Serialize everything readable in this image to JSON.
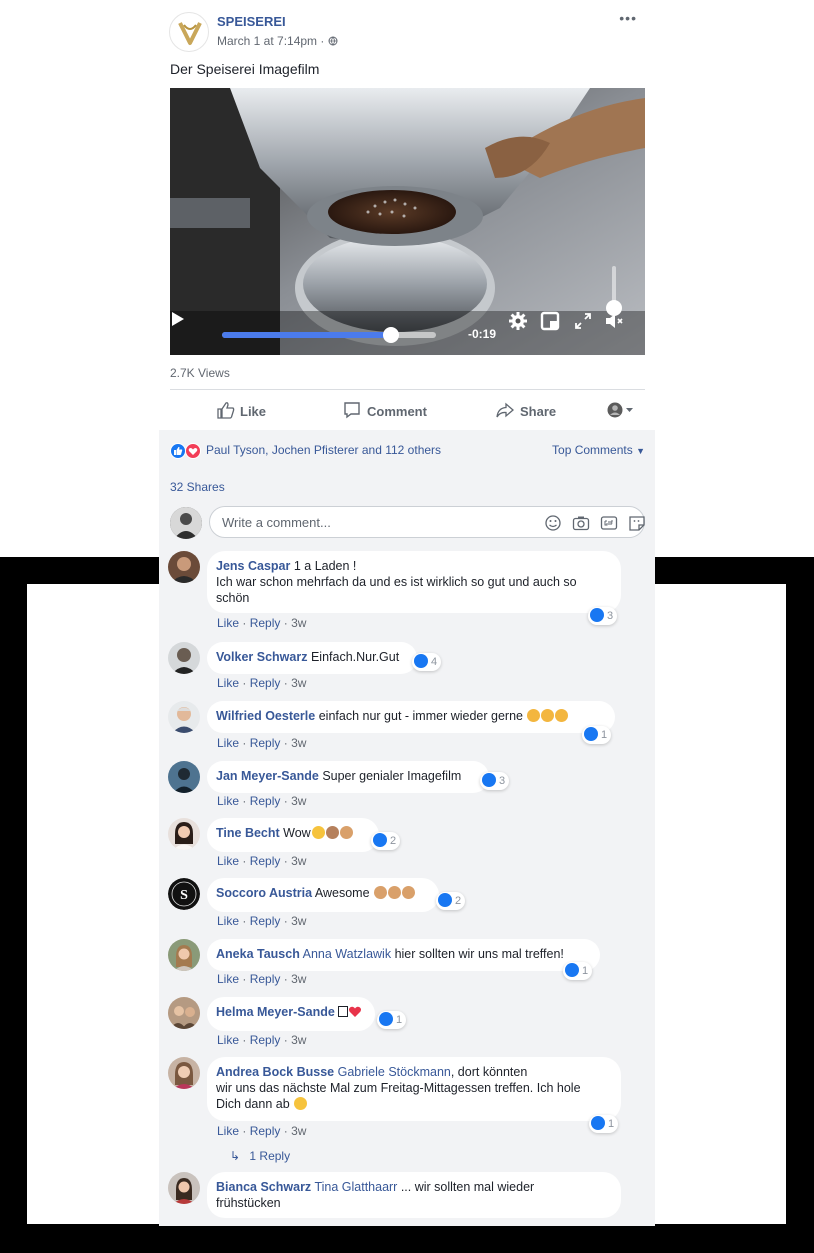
{
  "post": {
    "page_name": "SPEISEREI",
    "timestamp": "March 1 at 7:14pm",
    "time_separator": "·",
    "more_icon": "more-dots-icon",
    "text": "Der Speiserei Imagefilm",
    "video": {
      "time_remaining": "-0:19",
      "progress": 0.79,
      "volume": 0.0,
      "icons": [
        "play-icon",
        "settings-icon",
        "pip-icon",
        "fullscreen-icon",
        "mute-icon"
      ]
    },
    "views": "2.7K Views",
    "actions": {
      "like": "Like",
      "comment": "Comment",
      "share": "Share"
    },
    "reactions": {
      "summary": "Paul Tyson, Jochen Pfisterer and 112 others",
      "top_comments": "Top Comments"
    },
    "shares": "32 Shares",
    "comment_input": {
      "placeholder": "Write a comment..."
    }
  },
  "colors": {
    "link": "#385898",
    "like_blue": "#1877f2",
    "love_red": "#f33e58",
    "black_frame": "#000000"
  },
  "comment_actions": {
    "like": "Like",
    "reply": "Reply",
    "dot": "·"
  },
  "comments": [
    {
      "author": "Jens Caspar",
      "text": "1 a Laden !",
      "text2": "Ich war schon mehrfach da und es ist wirklich so gut und auch so",
      "text3": "schön",
      "likes": "3",
      "time": "3w"
    },
    {
      "author": "Volker Schwarz",
      "text": "Einfach.Nur.Gut",
      "likes": "4",
      "time": "3w"
    },
    {
      "author": "Wilfried Oesterle",
      "text": "einfach nur gut - immer wieder gerne",
      "likes": "1",
      "time": "3w"
    },
    {
      "author": "Jan Meyer-Sande",
      "text": "Super genialer Imagefilm",
      "likes": "3",
      "time": "3w"
    },
    {
      "author": "Tine Becht",
      "text": "Wow",
      "likes": "2",
      "time": "3w"
    },
    {
      "author": "Soccoro Austria",
      "text": "Awesome",
      "likes": "2",
      "time": "3w"
    },
    {
      "author": "Aneka Tausch",
      "mention": "Anna Watzlawik",
      "text": "hier sollten wir uns mal treffen!",
      "likes": "1",
      "time": "3w"
    },
    {
      "author": "Helma Meyer-Sande",
      "text": "",
      "likes": "1",
      "time": "3w"
    },
    {
      "author": "Andrea Bock Busse",
      "mention": "Gabriele Stöckmann",
      "text": ", dort könnten",
      "text2": "wir uns das nächste Mal zum Freitag-Mittagessen treffen. Ich hole",
      "text3": "Dich dann ab",
      "likes": "1",
      "time": "3w",
      "replies": "1 Reply"
    },
    {
      "author": "Bianca Schwarz",
      "mention": "Tina Glatthaarr",
      "text": "... wir sollten mal wieder",
      "text2": "frühstücken"
    }
  ]
}
